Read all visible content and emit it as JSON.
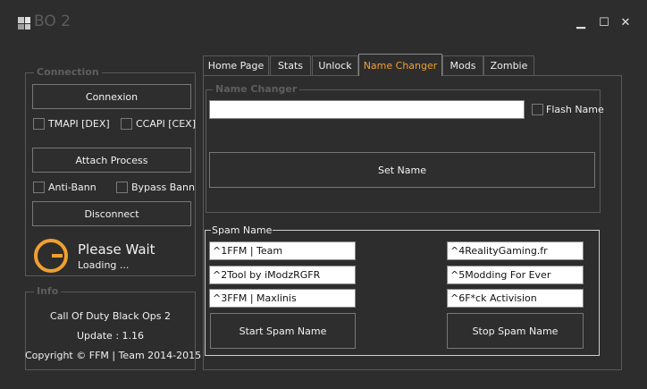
{
  "window": {
    "title": "BO 2",
    "minimize": "▁",
    "maximize": "☐",
    "close": "✕"
  },
  "connection": {
    "title": "Connection",
    "connect_label": "Connexion",
    "tmapi_label": "TMAPI [DEX]",
    "ccapi_label": "CCAPI [CEX]",
    "attach_label": "Attach Process",
    "antiban_label": "Anti-Bann",
    "bypass_label": "Bypass Bann",
    "disconnect_label": "Disconnect",
    "status_title": "Please Wait",
    "status_sub": "Loading ..."
  },
  "info": {
    "title": "Info",
    "game": "Call Of Duty Black Ops 2",
    "update": "Update : 1.16",
    "copyright": "Copyright © FFM | Team 2014-2015"
  },
  "tabs": [
    {
      "label": "Home Page"
    },
    {
      "label": "Stats"
    },
    {
      "label": "Unlock"
    },
    {
      "label": "Name Changer"
    },
    {
      "label": "Mods"
    },
    {
      "label": "Zombie"
    }
  ],
  "name_changer": {
    "title": "Name Changer",
    "name_value": "",
    "flash_label": "Flash Name",
    "set_label": "Set Name"
  },
  "spam": {
    "title": "Spam Name",
    "left": [
      "^1FFM |  Team",
      "^2Tool by iModzRGFR",
      "^3FFM | Maxlinis"
    ],
    "right": [
      "^4RealityGaming.fr",
      "^5Modding For Ever",
      "^6F*ck Activision"
    ],
    "start_label": "Start Spam Name",
    "stop_label": "Stop Spam Name"
  },
  "colors": {
    "accent": "#f0a030",
    "background": "#2d2d2d"
  }
}
